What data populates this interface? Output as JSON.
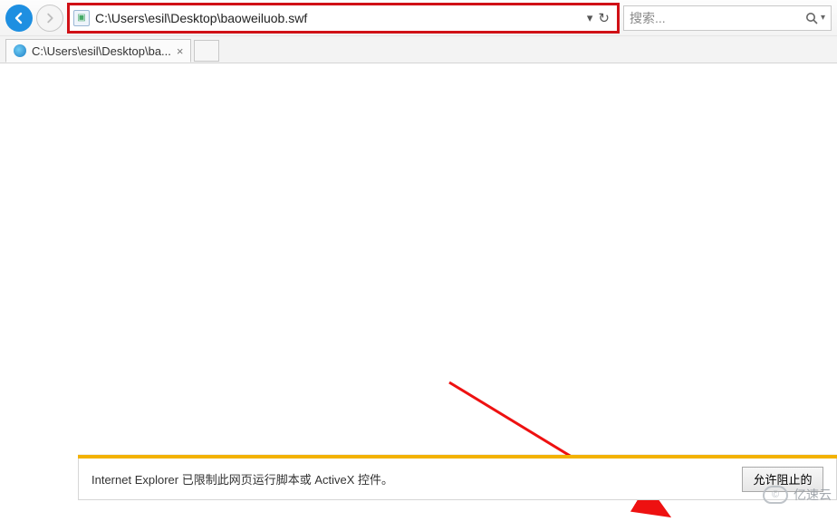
{
  "nav": {
    "address": "C:\\Users\\esil\\Desktop\\baoweiluob.swf",
    "search_placeholder": "搜索..."
  },
  "tabs": {
    "active": {
      "title": "C:\\Users\\esil\\Desktop\\ba..."
    }
  },
  "infobar": {
    "message": "Internet Explorer 已限制此网页运行脚本或 ActiveX 控件。",
    "allow_label": "允许阻止的"
  },
  "watermark": {
    "text": "亿速云"
  }
}
